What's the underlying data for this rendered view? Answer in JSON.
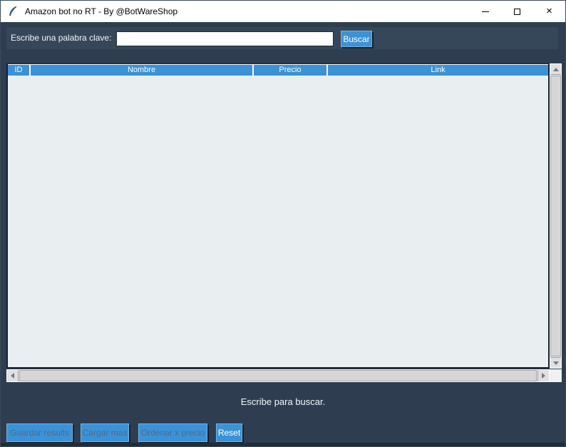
{
  "window": {
    "title": "Amazon bot no RT - By @BotWareShop"
  },
  "icons": {
    "app": "python-feather",
    "minimize": "minimize-line",
    "maximize": "maximize-box",
    "close": "×",
    "scroll_up": "triangle-up",
    "scroll_down": "triangle-down",
    "scroll_left": "triangle-left",
    "scroll_right": "triangle-right"
  },
  "search": {
    "label": "Escribe una palabra clave:",
    "input_value": "",
    "input_placeholder": "",
    "button_label": "Buscar"
  },
  "table": {
    "columns": [
      "ID",
      "Nombre",
      "Precio",
      "Link"
    ],
    "rows": []
  },
  "status": {
    "text": "Escribe para buscar."
  },
  "actions": {
    "buttons": [
      {
        "label": "Guardar results",
        "enabled": false
      },
      {
        "label": "Cargar mas",
        "enabled": false
      },
      {
        "label": "Ordenar x precio",
        "enabled": false
      },
      {
        "label": "Reset",
        "enabled": true
      }
    ]
  },
  "colors": {
    "accent_blue": "#3c92d6",
    "window_bg": "#2e3e50",
    "search_frame_bg": "#364759",
    "table_bg": "#e9eef1",
    "titlebar_bg": "#ffffff",
    "disabled_text": "#4d6c8a",
    "bottom_strip": "#1f2c3a"
  }
}
